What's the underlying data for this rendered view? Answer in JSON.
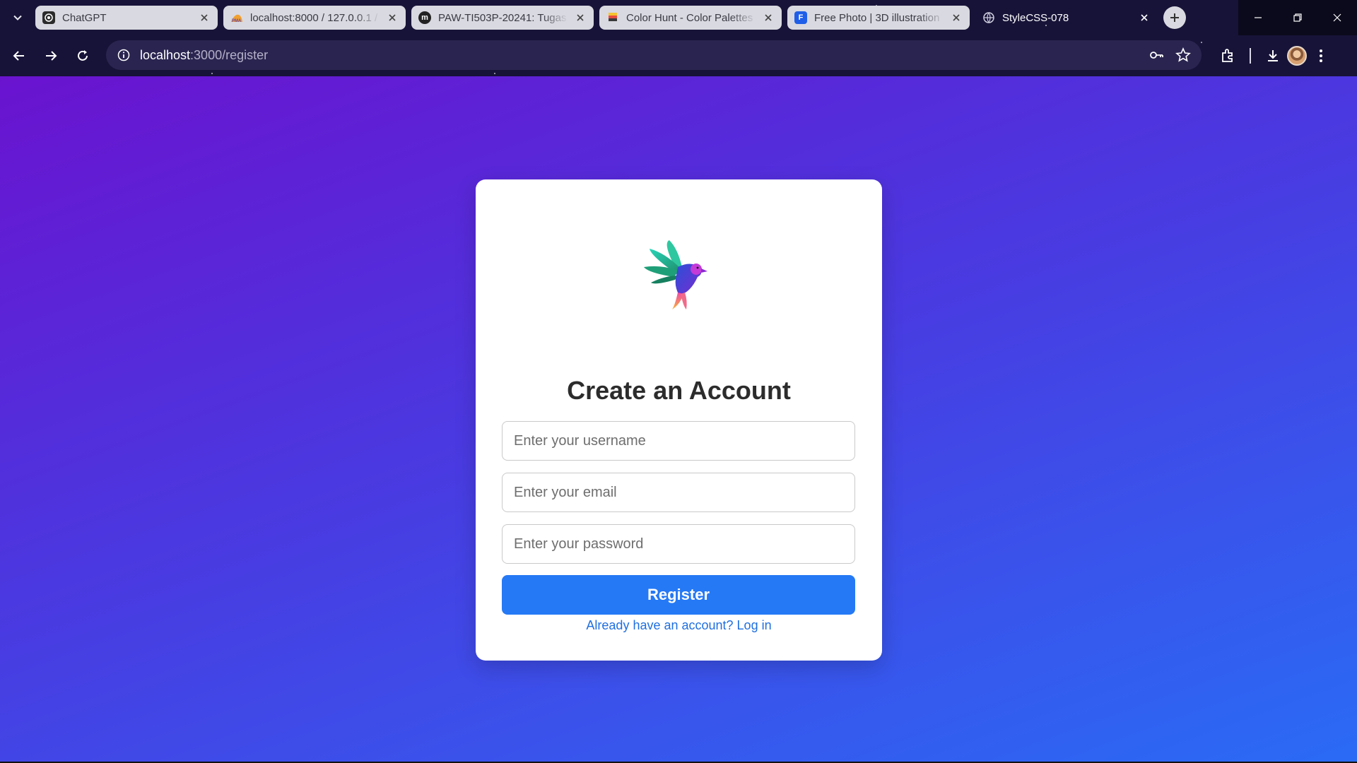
{
  "browser": {
    "tabs": [
      {
        "title": "ChatGPT",
        "icon": "chatgpt-icon",
        "active": false
      },
      {
        "title": "localhost:8000 / 127.0.0.1 /",
        "icon": "phpmyadmin-icon",
        "active": false
      },
      {
        "title": "PAW-TI503P-20241: Tugas",
        "icon": "m-logo-icon",
        "active": false
      },
      {
        "title": "Color Hunt - Color Palettes",
        "icon": "colorhunt-icon",
        "active": false
      },
      {
        "title": "Free Photo | 3D illustration",
        "icon": "freepik-icon",
        "active": false
      },
      {
        "title": "StyleCSS-078",
        "icon": "globe-icon",
        "active": true
      }
    ],
    "url_host": "localhost",
    "url_path": ":3000/register"
  },
  "page": {
    "title": "Create an Account",
    "username_placeholder": "Enter your username",
    "email_placeholder": "Enter your email",
    "password_placeholder": "Enter your password",
    "register_label": "Register",
    "login_link": "Already have an account? Log in"
  },
  "colors": {
    "gradient_start": "#6a13cf",
    "gradient_end": "#2a6bf5",
    "button": "#2579f5",
    "link": "#1f6fe0"
  }
}
